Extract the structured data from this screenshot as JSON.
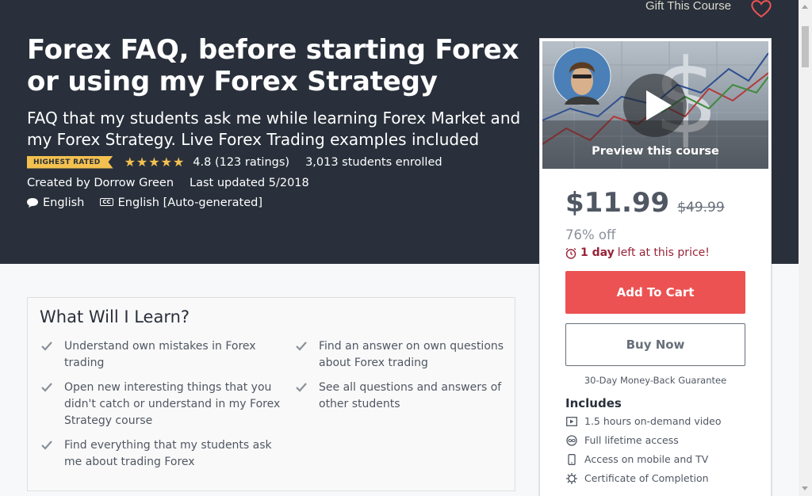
{
  "header": {
    "gift_label": "Gift This Course",
    "title": "Forex FAQ, before starting Forex or using my Forex Strategy",
    "subtitle": "FAQ that my students ask me while learning Forex Market and my Forex Strategy. Live Forex Trading examples included",
    "badge": "Highest rated",
    "stars": "★★★★★",
    "rating": "4.8 (123 ratings)",
    "students": "3,013 students enrolled",
    "created_by_label": "Created by",
    "author": "Dorrow Green",
    "last_updated": "Last updated 5/2018",
    "language": "English",
    "captions_icon": "CC",
    "captions": "English [Auto-generated]"
  },
  "sidebar": {
    "preview_label": "Preview this course",
    "price": "$11.99",
    "original_price": "$49.99",
    "discount": "76% off",
    "timer_bold": "1 day",
    "timer_text": "left at this price!",
    "add_to_cart": "Add To Cart",
    "buy_now": "Buy Now",
    "guarantee": "30-Day Money-Back Guarantee",
    "includes_title": "Includes",
    "includes": [
      {
        "icon": "video-icon",
        "label": "1.5 hours on-demand video"
      },
      {
        "icon": "infinity-icon",
        "label": "Full lifetime access"
      },
      {
        "icon": "mobile-icon",
        "label": "Access on mobile and TV"
      },
      {
        "icon": "certificate-icon",
        "label": "Certificate of Completion"
      }
    ]
  },
  "learn": {
    "title": "What Will I Learn?",
    "items": [
      "Understand own mistakes in Forex trading",
      "Find an answer on own questions about Forex trading",
      "Open new interesting things that you didn't catch or understand in my Forex Strategy course",
      "See all questions and answers of other students",
      "Find everything that my students ask me about trading Forex"
    ]
  },
  "colors": {
    "hero_bg": "#29303b",
    "accent_red": "#ec5252",
    "star": "#f4c150",
    "timer": "#992337"
  }
}
